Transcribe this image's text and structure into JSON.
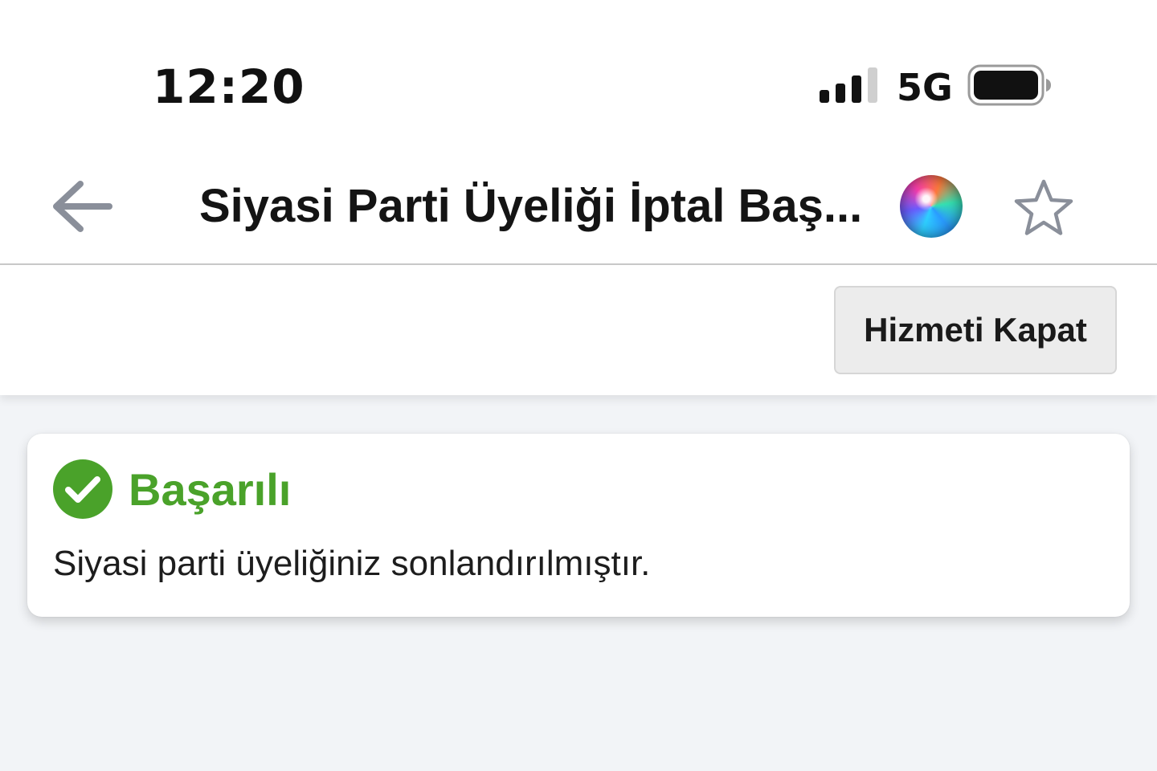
{
  "status_bar": {
    "time": "12:20",
    "network": "5G",
    "signal_level": 0.75,
    "battery_level": 0.95,
    "icons": [
      "cellular-signal-icon",
      "battery-icon"
    ]
  },
  "header": {
    "title": "Siyasi Parti Üyeliği İptal Baş...",
    "icons": [
      "back-arrow-icon",
      "siri-icon",
      "star-outline-icon"
    ]
  },
  "action_bar": {
    "close_service_label": "Hizmeti Kapat"
  },
  "alert": {
    "title": "Başarılı",
    "message": "Siyasi parti üyeliğiniz sonlandırılmıştır.",
    "icon": "check-circle-icon",
    "accent_color": "#4aa22a"
  }
}
